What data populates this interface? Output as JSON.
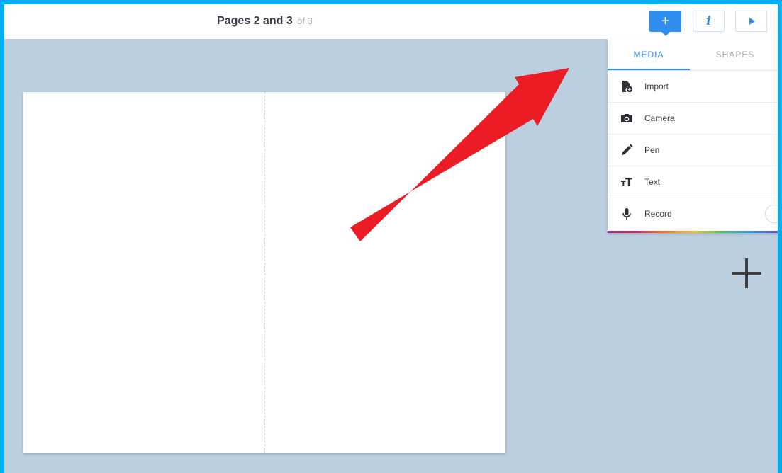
{
  "header": {
    "title": "Pages 2 and 3",
    "of_text": "of 3"
  },
  "toolbar": {
    "add_icon_glyph": "+",
    "info_icon_glyph": "i",
    "add_icon": "plus-icon",
    "info_icon": "info-icon",
    "play_icon": "play-icon"
  },
  "panel": {
    "tabs": [
      {
        "label": "MEDIA",
        "active": true
      },
      {
        "label": "SHAPES",
        "active": false
      }
    ],
    "items": [
      {
        "label": "Import",
        "icon": "file-import-icon"
      },
      {
        "label": "Camera",
        "icon": "camera-icon"
      },
      {
        "label": "Pen",
        "icon": "pen-icon"
      },
      {
        "label": "Text",
        "icon": "text-size-icon"
      },
      {
        "label": "Record",
        "icon": "microphone-icon"
      }
    ]
  },
  "colors": {
    "accent": "#2f8ef0",
    "workspace": "#bccfe1",
    "frame": "#00b0f0",
    "annotation_arrow": "#ec1c24"
  }
}
